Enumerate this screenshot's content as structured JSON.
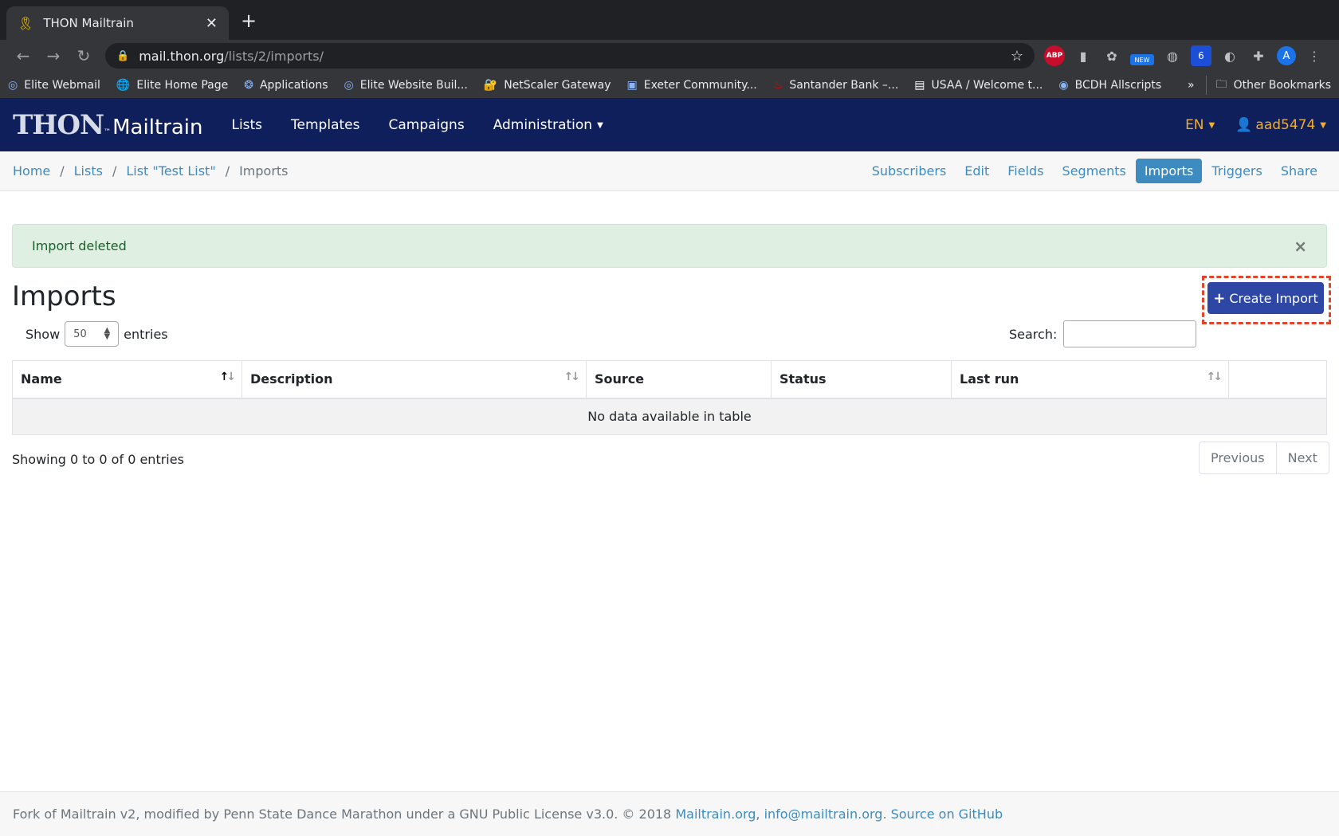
{
  "browser": {
    "tab_title": "THON Mailtrain",
    "url_host": "mail.thon.org",
    "url_path": "/lists/2/imports/",
    "bookmarks": [
      {
        "label": "Elite Webmail",
        "icon": "spiral-icon"
      },
      {
        "label": "Elite Home Page",
        "icon": "globe-icon"
      },
      {
        "label": "Applications",
        "icon": "brain-icon"
      },
      {
        "label": "Elite Website Buil...",
        "icon": "spiral-icon"
      },
      {
        "label": "NetScaler Gateway",
        "icon": "lock-icon"
      },
      {
        "label": "Exeter Community...",
        "icon": "building-icon"
      },
      {
        "label": "Santander Bank –...",
        "icon": "flame-icon"
      },
      {
        "label": "USAA / Welcome t...",
        "icon": "usaa-icon"
      },
      {
        "label": "BCDH Allscripts",
        "icon": "shield-icon"
      }
    ],
    "bookmarks_more": "»",
    "other_bookmarks": "Other Bookmarks",
    "ext_abp": "ABP",
    "ext_new": "NEW",
    "ext_badge": "6",
    "avatar_letter": "A"
  },
  "nav": {
    "brand_thon": "THON",
    "brand_tm": "™",
    "brand_mailtrain": "Mailtrain",
    "links": [
      "Lists",
      "Templates",
      "Campaigns",
      "Administration"
    ],
    "lang": "EN",
    "user": "aad5474"
  },
  "breadcrumb": {
    "home": "Home",
    "lists": "Lists",
    "list": "List \"Test List\"",
    "current": "Imports"
  },
  "subnav": [
    "Subscribers",
    "Edit",
    "Fields",
    "Segments",
    "Imports",
    "Triggers",
    "Share"
  ],
  "alert": {
    "message": "Import deleted",
    "close": "×"
  },
  "page": {
    "title": "Imports",
    "create_button": "Create Import",
    "show_label": "Show",
    "entries_label": "entries",
    "page_size": "50",
    "search_label": "Search:",
    "search_value": ""
  },
  "table": {
    "columns": [
      "Name",
      "Description",
      "Source",
      "Status",
      "Last run",
      ""
    ],
    "empty_text": "No data available in table",
    "info": "Showing 0 to 0 of 0 entries",
    "prev": "Previous",
    "next": "Next"
  },
  "footer": {
    "text": "Fork of Mailtrain v2, modified by Penn State Dance Marathon under a GNU Public License v3.0. © 2018 ",
    "link1": "Mailtrain.org",
    "comma": ", ",
    "link2": "info@mailtrain.org",
    "dot": ". ",
    "link3": "Source on GitHub"
  }
}
